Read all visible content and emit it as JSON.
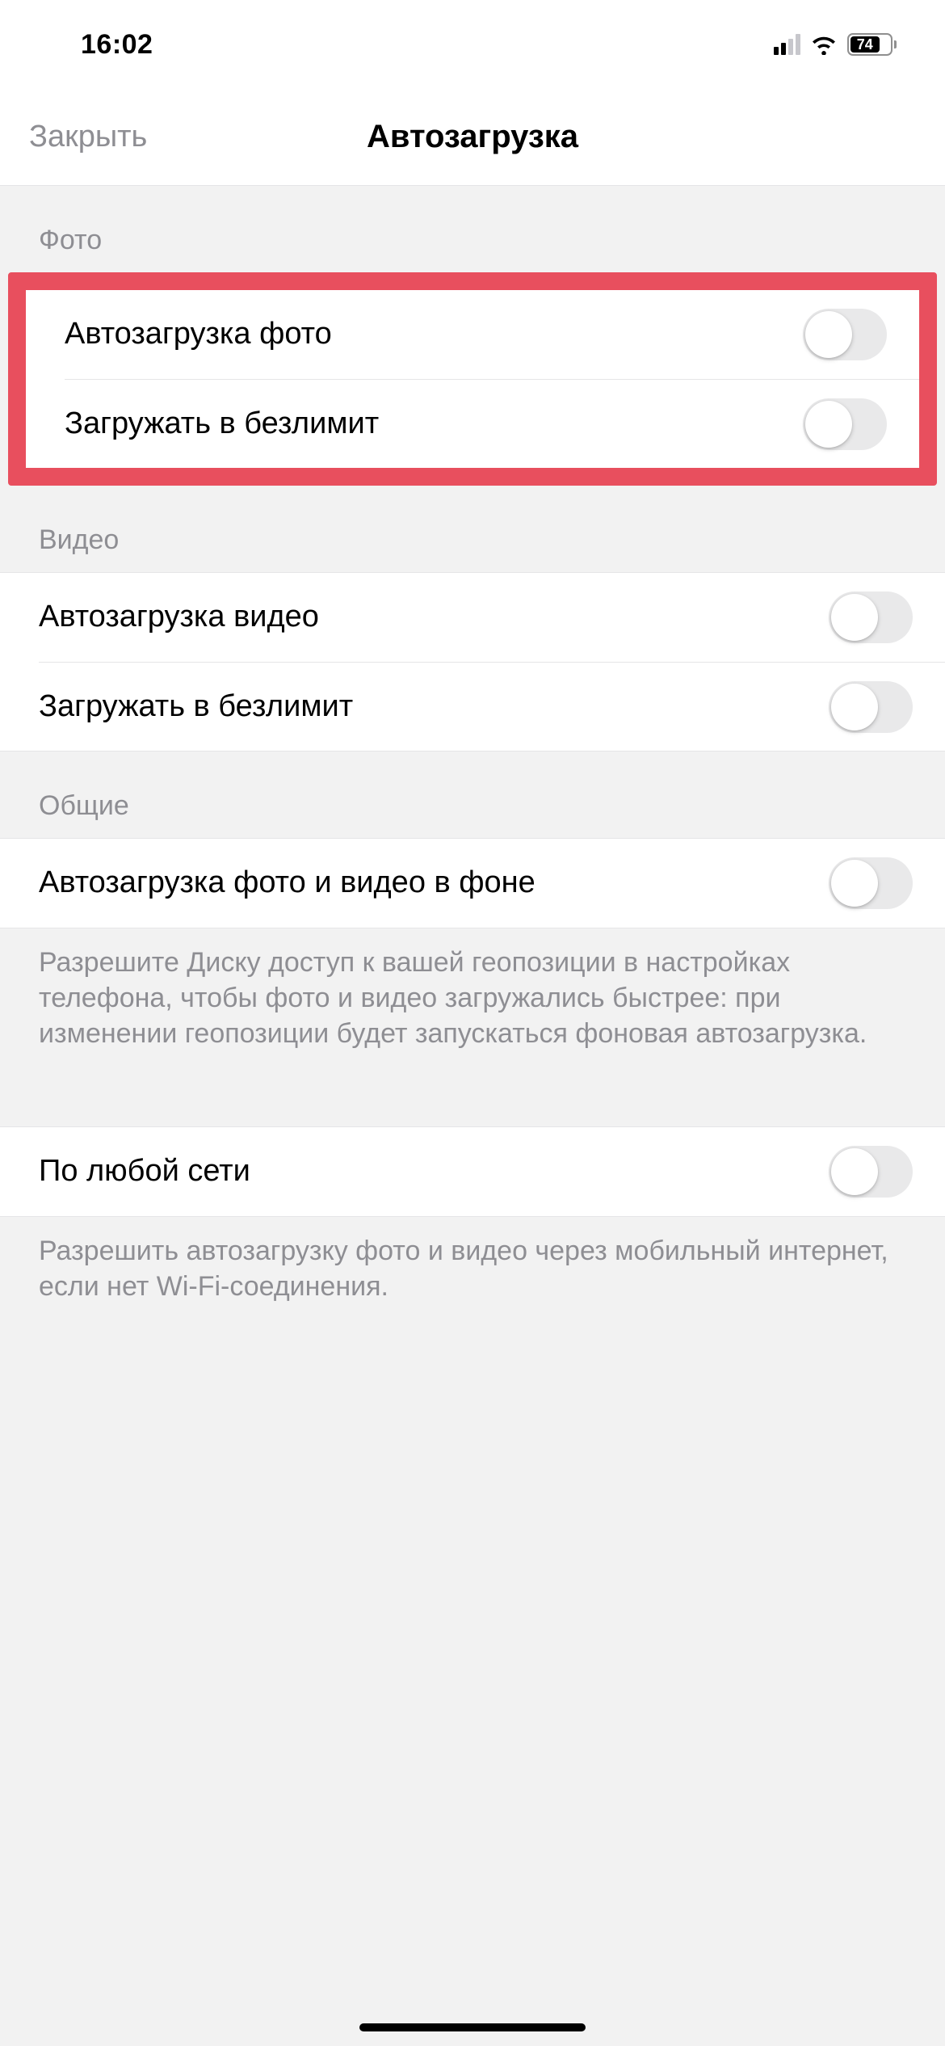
{
  "status": {
    "time": "16:02",
    "battery": "74"
  },
  "nav": {
    "close": "Закрыть",
    "title": "Автозагрузка"
  },
  "sections": {
    "photo": {
      "header": "Фото",
      "auto_upload": "Автозагрузка фото",
      "unlimited": "Загружать в безлимит"
    },
    "video": {
      "header": "Видео",
      "auto_upload": "Автозагрузка видео",
      "unlimited": "Загружать в безлимит"
    },
    "general": {
      "header": "Общие",
      "background": "Автозагрузка фото и видео в фоне",
      "background_footer": "Разрешите Диску доступ к вашей геопозиции в настройках телефона, чтобы фото и видео загружались быстрее: при изменении геопозиции будет запускаться фоновая автозагрузка.",
      "any_network": "По любой сети",
      "any_network_footer": "Разрешить автозагрузку фото и видео через мобильный интернет, если нет Wi-Fi-соединения."
    }
  }
}
